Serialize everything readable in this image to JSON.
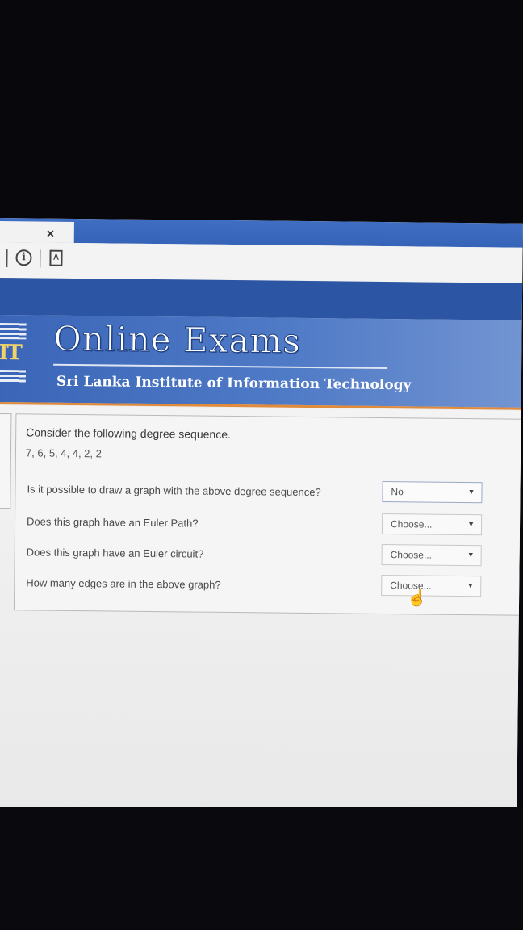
{
  "browser": {
    "tab_close": "×",
    "info_icon": "i",
    "page_icon": "A"
  },
  "header": {
    "title": "Online Exams",
    "subtitle": "Sri Lanka Institute of Information Technology",
    "logo_text": "IT"
  },
  "question": {
    "intro": "Consider the following degree sequence.",
    "sequence": "7, 6, 5, 4, 4, 2, 2",
    "items": [
      {
        "label": "Is it possible to draw a graph with the above degree sequence?",
        "value": "No",
        "arrow": "▼"
      },
      {
        "label": "Does this graph have an Euler Path?",
        "value": "Choose...",
        "arrow": "▼"
      },
      {
        "label": "Does this graph have an Euler circuit?",
        "value": "Choose...",
        "arrow": "▼"
      },
      {
        "label": "How many edges are in the above graph?",
        "value": "Choose...",
        "arrow": "▼"
      }
    ]
  },
  "cursor": "☝"
}
